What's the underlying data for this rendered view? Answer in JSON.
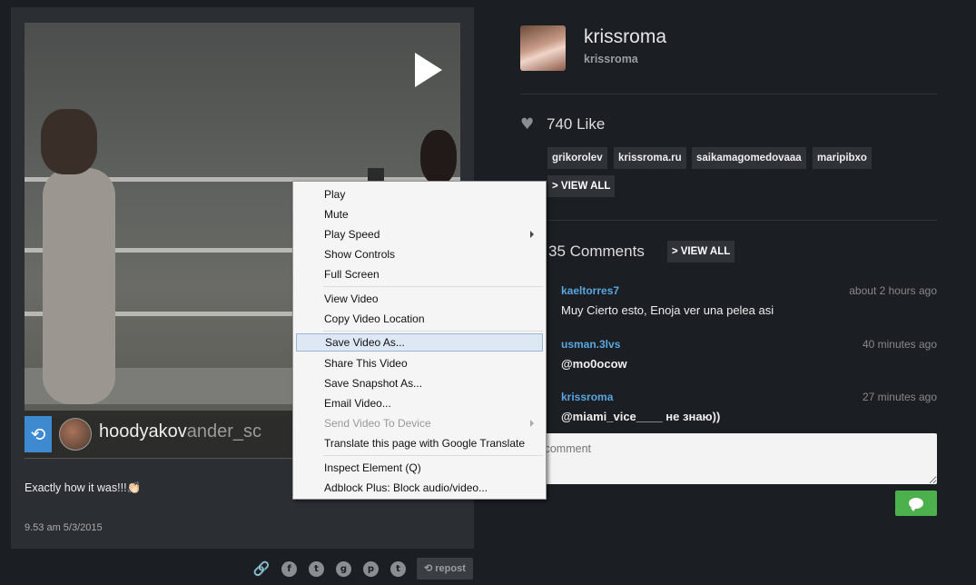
{
  "post": {
    "overlay_username": "hoodyakov",
    "overlay_username_faded": "ander_sc",
    "caption": "Exactly how it was!!!👏🏻",
    "timestamp": "9.53 am 5/3/2015",
    "repost_label": "repost"
  },
  "profile": {
    "name": "krissroma",
    "handle": "krissroma"
  },
  "likes": {
    "label": "740 Like",
    "tags": [
      "grikorolev",
      "krissroma.ru",
      "saikamagomedovaaa",
      "maripibxo"
    ],
    "view_all": "> VIEW ALL"
  },
  "comments": {
    "label": "35 Comments",
    "view_all": "> VIEW ALL",
    "items": [
      {
        "user": "kaeltorres7",
        "time": "about 2 hours ago",
        "text": "Muy Cierto esto, Enoja ver una pelea asi"
      },
      {
        "user": "usman.3lvs",
        "time": "40 minutes ago",
        "text": "@mo0ocow"
      },
      {
        "user": "krissroma",
        "time": "27 minutes ago",
        "text": "@miami_vice____ не знаю))"
      }
    ],
    "input_placeholder": "ur comment"
  },
  "context_menu": {
    "items": [
      "Play",
      "Mute",
      "Play Speed",
      "Show Controls",
      "Full Screen",
      "View Video",
      "Copy Video Location",
      "Save Video As...",
      "Share This Video",
      "Save Snapshot As...",
      "Email Video...",
      "Send Video To Device",
      "Translate this page with Google Translate",
      "Inspect Element (Q)",
      "Adblock Plus: Block audio/video..."
    ]
  },
  "icons": {
    "play": "play-icon",
    "repost": "repost-icon",
    "heart": "heart-icon",
    "link": "link-icon",
    "facebook": "facebook-icon",
    "twitter": "twitter-icon",
    "google_plus": "google-plus-icon",
    "pinterest": "pinterest-icon",
    "tumblr": "tumblr-icon",
    "chat": "chat-icon"
  },
  "colors": {
    "background": "#1b1e22",
    "card": "#2b2f34",
    "link_blue": "#5aa6e0",
    "send_green": "#4cb04c",
    "menu_highlight": "#dde8f4"
  }
}
